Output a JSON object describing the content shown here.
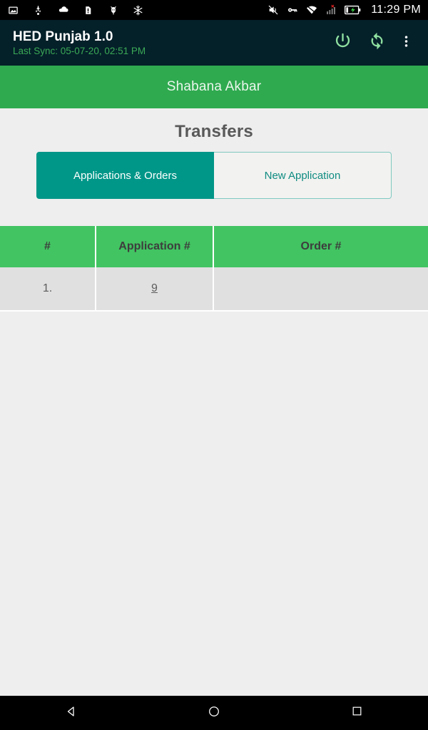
{
  "status_bar": {
    "left_icons": [
      {
        "name": "screenshot-icon"
      },
      {
        "name": "usb-icon"
      },
      {
        "name": "cloud-icon"
      },
      {
        "name": "sd-card-warning-icon"
      },
      {
        "name": "developer-icon"
      },
      {
        "name": "snowflake-icon"
      }
    ],
    "right_icons": [
      {
        "name": "volume-muted-icon"
      },
      {
        "name": "vpn-key-icon"
      },
      {
        "name": "wifi-off-icon"
      },
      {
        "name": "signal-no-sim-icon"
      },
      {
        "name": "battery-charging-icon"
      }
    ],
    "clock": "11:29 PM"
  },
  "toolbar": {
    "title": "HED Punjab 1.0",
    "subtitle": "Last Sync: 05-07-20, 02:51 PM",
    "actions": [
      {
        "name": "power-icon",
        "label": "Logout"
      },
      {
        "name": "sync-icon",
        "label": "Sync"
      },
      {
        "name": "overflow-menu-icon",
        "label": "More options"
      }
    ]
  },
  "user_bar": {
    "user_name": "Shabana Akbar"
  },
  "main": {
    "page_title": "Transfers",
    "tabs": [
      {
        "label": "Applications & Orders",
        "active": true
      },
      {
        "label": "New Application",
        "active": false
      }
    ],
    "table": {
      "columns": [
        "#",
        "Application #",
        "Order #"
      ],
      "rows": [
        {
          "num": "1.",
          "application": "9",
          "order": ""
        }
      ]
    }
  },
  "nav_bar": {
    "buttons": [
      {
        "name": "back-button"
      },
      {
        "name": "home-button"
      },
      {
        "name": "recents-button"
      }
    ]
  },
  "colors": {
    "toolbar_bg": "#042029",
    "accent_green": "#2faa4f",
    "table_header_green": "#42c462",
    "tab_active_teal": "#009688",
    "tab_inactive_text": "#0f8c82",
    "page_bg": "#eeeeee",
    "row_bg": "#e0e0e0",
    "sync_text": "#3ba956"
  }
}
